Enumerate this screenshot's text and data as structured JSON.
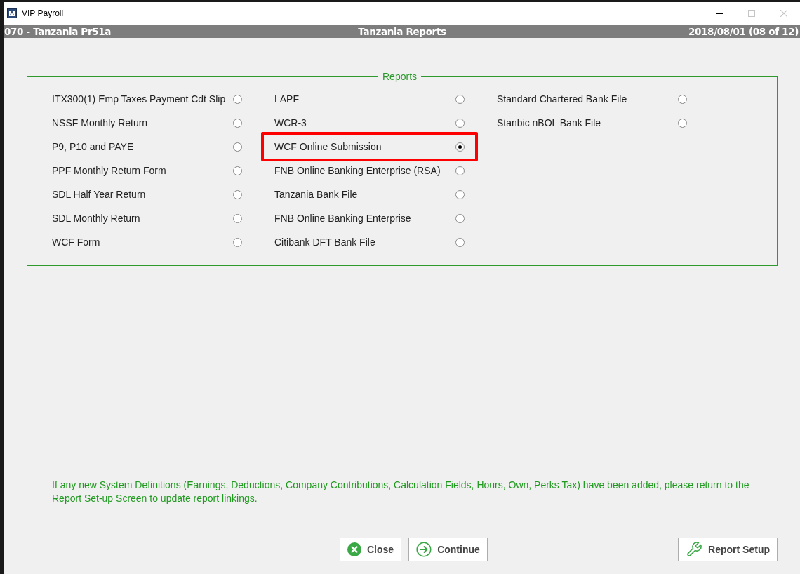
{
  "window": {
    "title": "VIP Payroll"
  },
  "header": {
    "left": "070 - Tanzania Pr51a",
    "center": "Tanzania Reports",
    "right": "2018/08/01 (08 of 12)"
  },
  "group": {
    "title": "Reports",
    "columns": [
      [
        {
          "label": "ITX300(1) Emp Taxes Payment Cdt Slip",
          "selected": false,
          "highlighted": false
        },
        {
          "label": "NSSF Monthly Return",
          "selected": false,
          "highlighted": false
        },
        {
          "label": "P9, P10 and PAYE",
          "selected": false,
          "highlighted": false
        },
        {
          "label": "PPF Monthly Return Form",
          "selected": false,
          "highlighted": false
        },
        {
          "label": "SDL Half Year Return",
          "selected": false,
          "highlighted": false
        },
        {
          "label": "SDL Monthly Return",
          "selected": false,
          "highlighted": false
        },
        {
          "label": "WCF Form",
          "selected": false,
          "highlighted": false
        }
      ],
      [
        {
          "label": "LAPF",
          "selected": false,
          "highlighted": false
        },
        {
          "label": "WCR-3",
          "selected": false,
          "highlighted": false
        },
        {
          "label": "WCF Online Submission",
          "selected": true,
          "highlighted": true
        },
        {
          "label": "FNB Online Banking Enterprise (RSA)",
          "selected": false,
          "highlighted": false
        },
        {
          "label": "Tanzania Bank File",
          "selected": false,
          "highlighted": false
        },
        {
          "label": "FNB Online Banking Enterprise",
          "selected": false,
          "highlighted": false
        },
        {
          "label": "Citibank DFT Bank File",
          "selected": false,
          "highlighted": false
        }
      ],
      [
        {
          "label": "Standard Chartered Bank File",
          "selected": false,
          "highlighted": false
        },
        {
          "label": "Stanbic nBOL Bank File",
          "selected": false,
          "highlighted": false
        }
      ]
    ]
  },
  "message": "If any new System Definitions (Earnings, Deductions, Company Contributions, Calculation Fields, Hours, Own, Perks Tax) have been added, please return to the Report Set-up Screen to update report linkings.",
  "buttons": [
    {
      "kind": "close",
      "label": "Close"
    },
    {
      "kind": "continue",
      "label": "Continue"
    },
    {
      "kind": "setup",
      "label": "Report Setup"
    }
  ]
}
